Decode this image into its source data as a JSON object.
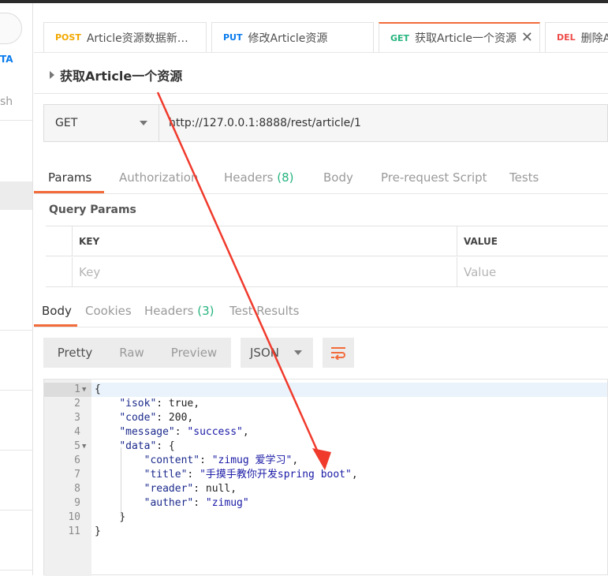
{
  "sidebar": {
    "fragment_top": "TA",
    "fragment_mid": "sh"
  },
  "tabs": [
    {
      "method": "POST",
      "method_color": "#f2a800",
      "label": "Article资源数据新…"
    },
    {
      "method": "PUT",
      "method_color": "#097bed",
      "label": "修改Article资源"
    },
    {
      "method": "GET",
      "method_color": "#26b47f",
      "label": "获取Article一个资源",
      "close": "✕"
    },
    {
      "method": "DEL",
      "method_color": "#ed4b48",
      "label": "删除A"
    }
  ],
  "request": {
    "title": "获取Article一个资源",
    "method": "GET",
    "url": "http://127.0.0.1:8888/rest/article/1"
  },
  "request_tabs": {
    "params": "Params",
    "authorization": "Authorization",
    "headers": "Headers",
    "headers_count": "(8)",
    "body": "Body",
    "prerequest": "Pre-request Script",
    "tests": "Tests"
  },
  "query_params": {
    "title": "Query Params",
    "key_header": "KEY",
    "value_header": "VALUE",
    "key_placeholder": "Key",
    "value_placeholder": "Value"
  },
  "response_tabs": {
    "body": "Body",
    "cookies": "Cookies",
    "headers": "Headers",
    "headers_count": "(3)",
    "test_results": "Test Results"
  },
  "view_toolbar": {
    "pretty": "Pretty",
    "raw": "Raw",
    "preview": "Preview",
    "format": "JSON"
  },
  "code_lines": [
    {
      "n": "1",
      "indent": "",
      "parts": [
        [
          "p",
          "{"
        ]
      ]
    },
    {
      "n": "2",
      "indent": "    ",
      "parts": [
        [
          "k",
          "\"isok\""
        ],
        [
          "p",
          ": true,"
        ]
      ]
    },
    {
      "n": "3",
      "indent": "    ",
      "parts": [
        [
          "k",
          "\"code\""
        ],
        [
          "p",
          ": 200,"
        ]
      ]
    },
    {
      "n": "4",
      "indent": "    ",
      "parts": [
        [
          "k",
          "\"message\""
        ],
        [
          "p",
          ": "
        ],
        [
          "s",
          "\"success\""
        ],
        [
          "p",
          ","
        ]
      ]
    },
    {
      "n": "5",
      "indent": "    ",
      "parts": [
        [
          "k",
          "\"data\""
        ],
        [
          "p",
          ": {"
        ]
      ]
    },
    {
      "n": "6",
      "indent": "        ",
      "parts": [
        [
          "k",
          "\"content\""
        ],
        [
          "p",
          ": "
        ],
        [
          "s",
          "\"zimug 爱学习\""
        ],
        [
          "p",
          ","
        ]
      ]
    },
    {
      "n": "7",
      "indent": "        ",
      "parts": [
        [
          "k",
          "\"title\""
        ],
        [
          "p",
          ": "
        ],
        [
          "s",
          "\"手摸手教你开发spring boot\""
        ],
        [
          "p",
          ","
        ]
      ]
    },
    {
      "n": "8",
      "indent": "        ",
      "parts": [
        [
          "k",
          "\"reader\""
        ],
        [
          "p",
          ": null,"
        ]
      ]
    },
    {
      "n": "9",
      "indent": "        ",
      "parts": [
        [
          "k",
          "\"auther\""
        ],
        [
          "p",
          ": "
        ],
        [
          "s",
          "\"zimug\""
        ]
      ]
    },
    {
      "n": "10",
      "indent": "    ",
      "parts": [
        [
          "p",
          "}"
        ]
      ]
    },
    {
      "n": "11",
      "indent": "",
      "parts": [
        [
          "p",
          "}"
        ]
      ]
    }
  ],
  "colors": {
    "accent": "#f26b3a",
    "arrow": "#f03a2c",
    "count_green": "#26b47f"
  }
}
